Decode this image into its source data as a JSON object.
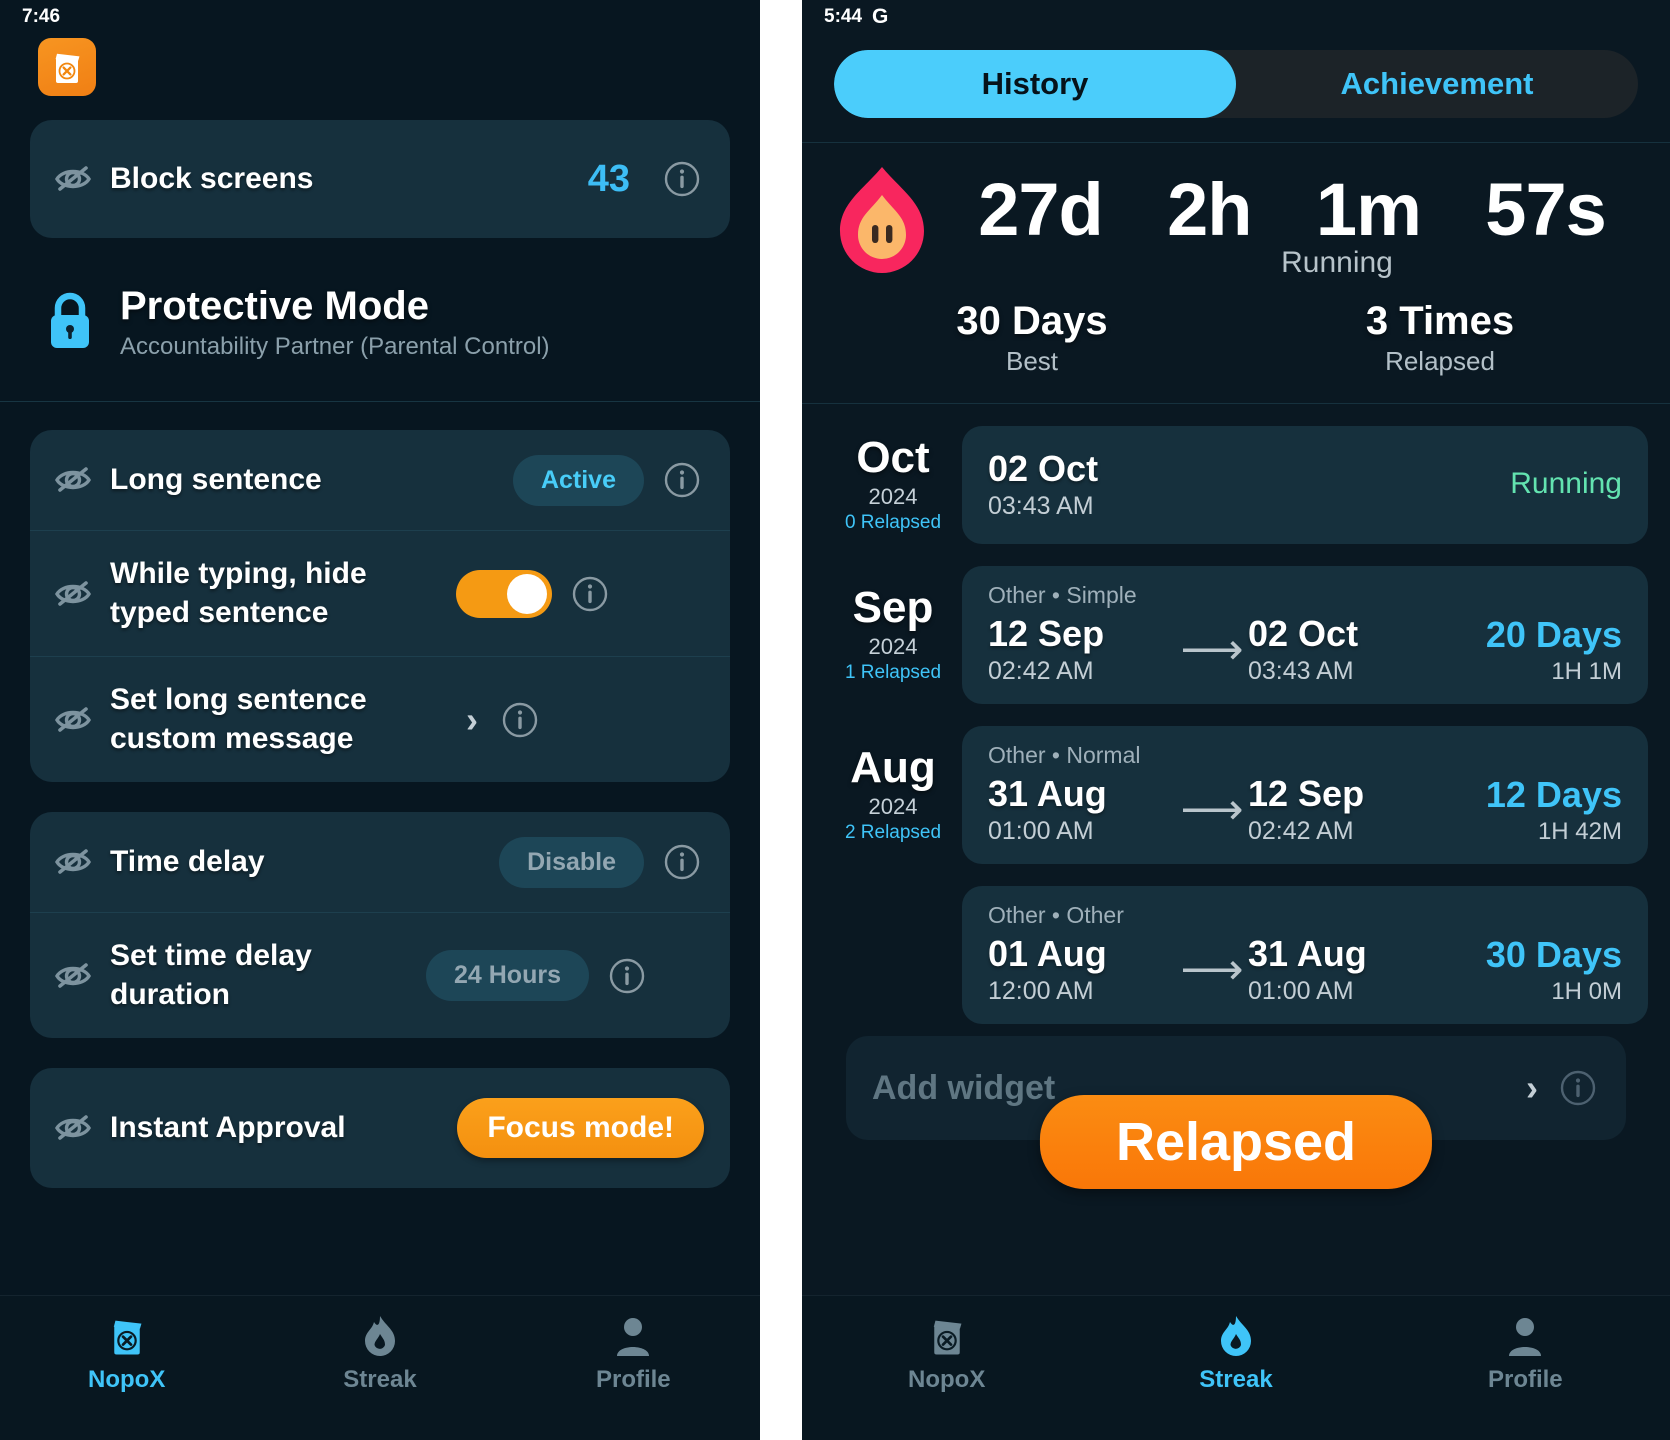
{
  "left": {
    "status_time": "7:46",
    "app_icon": "nopox-app-icon",
    "block_screens": {
      "label": "Block screens",
      "count": "43",
      "icon": "eye-slash-icon",
      "info": "info-icon"
    },
    "protective": {
      "icon": "lock-icon",
      "title": "Protective Mode",
      "subtitle": "Accountability Partner (Parental Control)"
    },
    "group_sentence": [
      {
        "label": "Long sentence",
        "control": "badge",
        "value": "Active",
        "muted": false
      },
      {
        "label": "While typing, hide typed sentence",
        "control": "toggle",
        "value": "on"
      },
      {
        "label": "Set long sentence custom message",
        "control": "chevron",
        "value": "›"
      }
    ],
    "group_delay": [
      {
        "label": "Time delay",
        "control": "badge",
        "value": "Disable",
        "muted": true
      },
      {
        "label": "Set time delay duration",
        "control": "badge",
        "value": "24 Hours",
        "muted": true
      }
    ],
    "group_instant": [
      {
        "label": "Instant Approval",
        "control": "button",
        "value": "Focus mode!"
      }
    ],
    "nav": [
      {
        "label": "NopoX",
        "icon": "clapperboard-x-icon",
        "active": true
      },
      {
        "label": "Streak",
        "icon": "flame-icon",
        "active": false
      },
      {
        "label": "Profile",
        "icon": "person-icon",
        "active": false
      }
    ]
  },
  "right": {
    "status_time": "5:44",
    "status_badge": "G",
    "tabs": [
      {
        "label": "History",
        "active": true
      },
      {
        "label": "Achievement",
        "active": false
      }
    ],
    "streak": {
      "flame_icon": "flame-icon",
      "timer": [
        "27d",
        "2h",
        "1m",
        "57s"
      ],
      "running_label": "Running",
      "best_value": "30 Days",
      "best_label": "Best",
      "relapsed_value": "3 Times",
      "relapsed_label": "Relapsed"
    },
    "history": [
      {
        "month": "Oct",
        "year": "2024",
        "relapsed": "0 Relapsed",
        "tag": "",
        "start_date": "02 Oct",
        "start_time": "03:43 AM",
        "end_date": "",
        "end_time": "",
        "days": "",
        "duration": "",
        "status": "Running"
      },
      {
        "month": "Sep",
        "year": "2024",
        "relapsed": "1 Relapsed",
        "tag": "Other • Simple",
        "start_date": "12 Sep",
        "start_time": "02:42 AM",
        "end_date": "02 Oct",
        "end_time": "03:43 AM",
        "days": "20 Days",
        "duration": "1H 1M",
        "status": ""
      },
      {
        "month": "Aug",
        "year": "2024",
        "relapsed": "2 Relapsed",
        "tag": "Other • Normal",
        "start_date": "31 Aug",
        "start_time": "01:00 AM",
        "end_date": "12 Sep",
        "end_time": "02:42 AM",
        "days": "12 Days",
        "duration": "1H 42M",
        "status": ""
      },
      {
        "month": "",
        "year": "",
        "relapsed": "",
        "tag": "Other • Other",
        "start_date": "01 Aug",
        "start_time": "12:00 AM",
        "end_date": "31 Aug",
        "end_time": "01:00 AM",
        "days": "30 Days",
        "duration": "1H 0M",
        "status": ""
      }
    ],
    "relapsed_button": "Relapsed",
    "add_widget": {
      "label": "Add widget",
      "chevron": "›"
    },
    "nav": [
      {
        "label": "NopoX",
        "icon": "clapperboard-x-icon",
        "active": false
      },
      {
        "label": "Streak",
        "icon": "flame-icon",
        "active": true
      },
      {
        "label": "Profile",
        "icon": "person-icon",
        "active": false
      }
    ]
  },
  "colors": {
    "accent_cyan": "#3FC4F8",
    "accent_orange": "#F79110",
    "card": "#16303d",
    "bg": "#0A1822",
    "running_green": "#63E3B0",
    "flame_pink": "#F8265E"
  }
}
